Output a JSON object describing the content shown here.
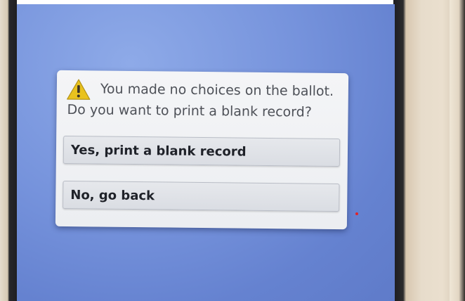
{
  "dialog": {
    "icon": "warning-icon",
    "message_line1": "You made no choices on the ballot.",
    "message_line2": "Do you want to print a blank record?",
    "yes_label": "Yes, print a blank record",
    "no_label": "No, go back"
  },
  "colors": {
    "screen_background": "#7693dc",
    "dialog_background": "#f1f2f4",
    "button_background": "#e1e3e8",
    "warning_triangle": "#e9c21e",
    "indicator_dot": "#e0242a"
  }
}
